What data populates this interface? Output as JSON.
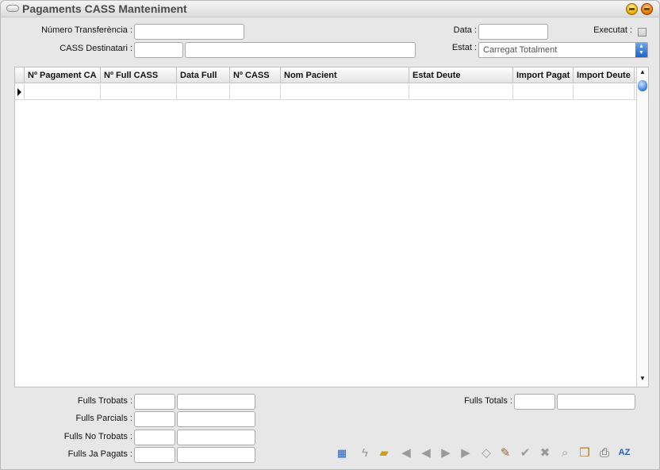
{
  "window": {
    "title": "Pagaments CASS Manteniment"
  },
  "form": {
    "numero_transferencia_label": "Número Transferència :",
    "cass_destinatari_label": "CASS Destinatari :",
    "data_label": "Data :",
    "executat_label": "Executat :",
    "estat_label": "Estat :",
    "estat_value": "Carregat Totalment",
    "numero_transferencia_value": "",
    "data_value": "",
    "cass_destinatari_code": "",
    "cass_destinatari_name": "",
    "executat_checked": false
  },
  "grid": {
    "columns": [
      "Nº Pagament CA",
      "Nº Full CASS",
      "Data Full",
      "Nº CASS",
      "Nom Pacient",
      "Estat Deute",
      "Import Pagat",
      "Import Deute"
    ],
    "rows": [
      [
        "",
        "",
        "",
        "",
        "",
        "",
        "",
        ""
      ]
    ]
  },
  "summary": {
    "fulls_trobats_label": "Fulls Trobats :",
    "fulls_parcials_label": "Fulls Parcials :",
    "fulls_no_trobats_label": "Fulls No Trobats :",
    "fulls_ja_pagats_label": "Fulls Ja Pagats :",
    "fulls_totals_label": "Fulls Totals :"
  },
  "toolbar": {
    "icons": [
      "calculator-icon",
      "lightning-icon",
      "folder-open-icon",
      "first-record-icon",
      "previous-record-icon",
      "next-record-icon",
      "last-record-icon",
      "eraser-icon",
      "edit-icon",
      "confirm-icon",
      "cancel-icon",
      "search-icon",
      "book-icon",
      "print-icon",
      "sort-az-icon"
    ],
    "sort_glyph": "AZ"
  }
}
